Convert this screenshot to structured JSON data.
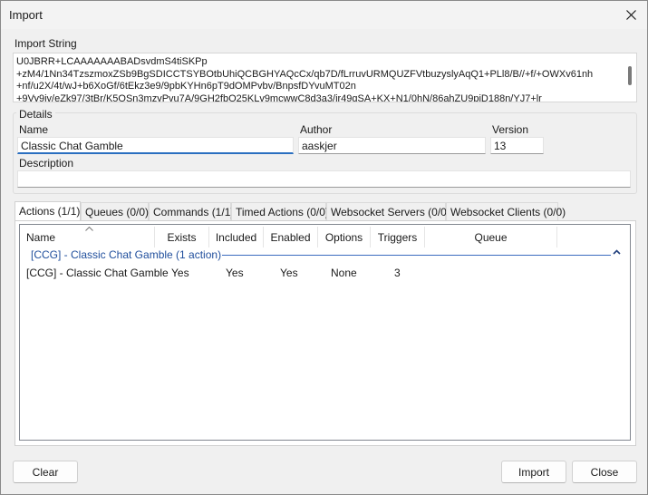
{
  "window": {
    "title": "Import"
  },
  "import_string": {
    "label": "Import String",
    "lines": [
      "U0JBRR+LCAAAAAAABADsvdmS4tiSKPp",
      "+zM4/1Nn34TzszmoxZSb9BgSDICCTSYBOtbUhiQCBGHYAQcCx/qb7D/fLrruvURMQUZFVtbuzyslyAqQ1+PLl8/B//+f/+OWXv61nh",
      "+nf/u2X/4t/wJ+b6XoGf/6tEkz3e9/9pbKYHn6pT9dOMPvbv/BnpsfDYvuMT02n",
      "+9Vy9iv/eZk97/3tBr/K5OSn3mzvPvu7A/9GH2fbO25KLv9mcwwC8d3a3/jr49qSA+KX+N1/0hN/86ahZU9pjD188n/YJ7+lr"
    ]
  },
  "details": {
    "legend": "Details",
    "name_label": "Name",
    "name_value": "Classic Chat Gamble",
    "author_label": "Author",
    "author_value": "aaskjer",
    "version_label": "Version",
    "version_value": "13",
    "description_label": "Description",
    "description_value": ""
  },
  "tabs": [
    {
      "label": "Actions (1/1)",
      "active": true
    },
    {
      "label": "Queues (0/0)",
      "active": false
    },
    {
      "label": "Commands (1/1)",
      "active": false
    },
    {
      "label": "Timed Actions (0/0)",
      "active": false
    },
    {
      "label": "Websocket Servers (0/0)",
      "active": false
    },
    {
      "label": "Websocket Clients (0/0)",
      "active": false
    }
  ],
  "list": {
    "columns": [
      "Name",
      "Exists",
      "Included",
      "Enabled",
      "Options",
      "Triggers",
      "Queue"
    ],
    "group_header": "[CCG] - Classic Chat Gamble (1 action)",
    "rows": [
      {
        "name": "[CCG] - Classic Chat Gamble",
        "exists": "Yes",
        "included": "Yes",
        "enabled": "Yes",
        "options": "None",
        "triggers": "3",
        "queue": ""
      }
    ]
  },
  "buttons": {
    "clear": "Clear",
    "import": "Import",
    "close": "Close"
  },
  "icons": {
    "close": "close-icon",
    "sort": "sort-caret-icon",
    "group_toggle": "chevron-up-icon"
  },
  "colors": {
    "accent": "#2a6fc0",
    "group_text": "#1f4e9c"
  }
}
